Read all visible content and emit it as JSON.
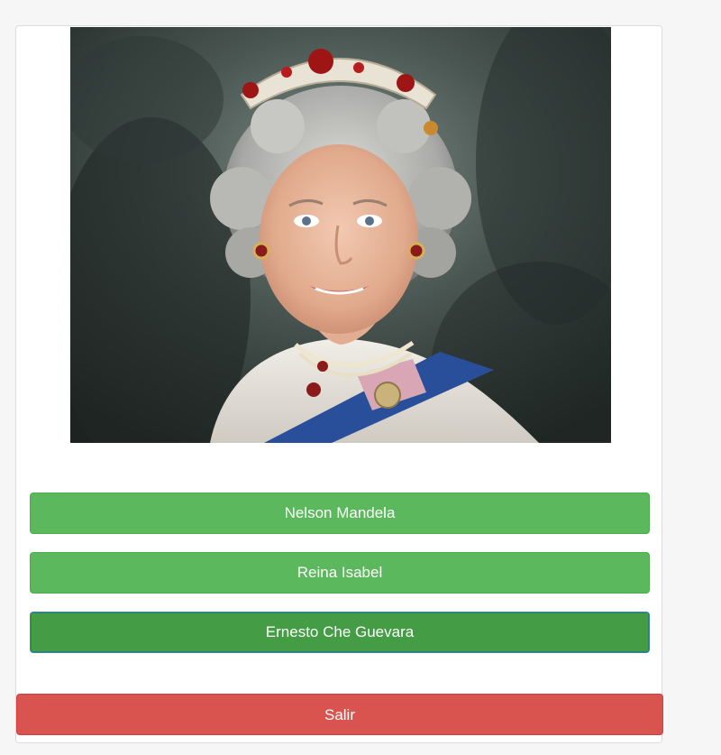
{
  "quiz": {
    "image_alt": "portrait",
    "options": [
      {
        "label": "Nelson Mandela",
        "state": "normal"
      },
      {
        "label": "Reina Isabel",
        "state": "normal"
      },
      {
        "label": "Ernesto Che Guevara",
        "state": "focused"
      }
    ],
    "exit_label": "Salir"
  },
  "colors": {
    "answer_bg": "#5cb85c",
    "answer_focused_bg": "#449d44",
    "exit_bg": "#d9534f",
    "card_bg": "#ffffff",
    "page_bg": "#f6f6f6"
  }
}
